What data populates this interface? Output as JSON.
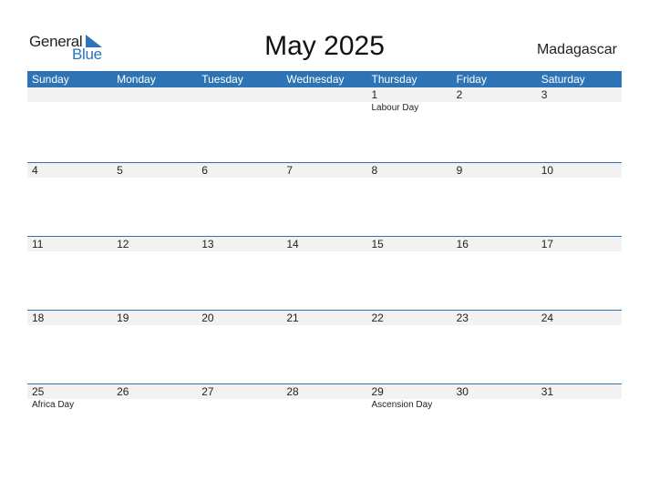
{
  "logo": {
    "word1": "General",
    "word2": "Blue"
  },
  "title": "May 2025",
  "country": "Madagascar",
  "colors": {
    "accent": "#2e74b5",
    "band": "#f2f2f2"
  },
  "weekdays": [
    "Sunday",
    "Monday",
    "Tuesday",
    "Wednesday",
    "Thursday",
    "Friday",
    "Saturday"
  ],
  "weeks": [
    {
      "days": [
        "",
        "",
        "",
        "",
        "1",
        "2",
        "3"
      ],
      "holidays": [
        "",
        "",
        "",
        "",
        "Labour Day",
        "",
        ""
      ]
    },
    {
      "days": [
        "4",
        "5",
        "6",
        "7",
        "8",
        "9",
        "10"
      ],
      "holidays": [
        "",
        "",
        "",
        "",
        "",
        "",
        ""
      ]
    },
    {
      "days": [
        "11",
        "12",
        "13",
        "14",
        "15",
        "16",
        "17"
      ],
      "holidays": [
        "",
        "",
        "",
        "",
        "",
        "",
        ""
      ]
    },
    {
      "days": [
        "18",
        "19",
        "20",
        "21",
        "22",
        "23",
        "24"
      ],
      "holidays": [
        "",
        "",
        "",
        "",
        "",
        "",
        ""
      ]
    },
    {
      "days": [
        "25",
        "26",
        "27",
        "28",
        "29",
        "30",
        "31"
      ],
      "holidays": [
        "Africa Day",
        "",
        "",
        "",
        "Ascension Day",
        "",
        ""
      ]
    }
  ]
}
